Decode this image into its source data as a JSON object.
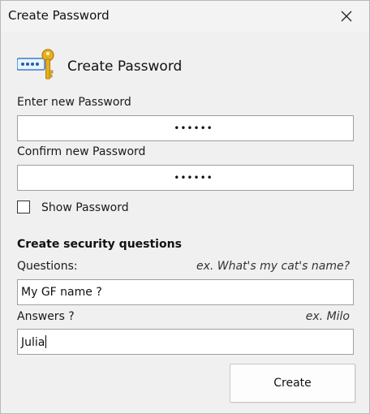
{
  "window": {
    "title": "Create Password"
  },
  "header": {
    "icon": "password-key-icon",
    "title": "Create Password"
  },
  "form": {
    "new_password_label": "Enter new Password",
    "new_password_value": "••••••",
    "confirm_password_label": "Confirm new Password",
    "confirm_password_value": "••••••",
    "show_password_label": "Show Password",
    "show_password_checked": false
  },
  "security": {
    "section_title": "Create security questions",
    "questions_label": "Questions:",
    "questions_hint": "ex. What's my cat's name?",
    "question_value": "My GF name ?",
    "answers_label": "Answers ?",
    "answers_hint": "ex. Milo",
    "answer_value": "Julia"
  },
  "actions": {
    "create_label": "Create"
  },
  "colors": {
    "key_gold": "#e6b01f",
    "field_blue": "#3b7fd0"
  }
}
